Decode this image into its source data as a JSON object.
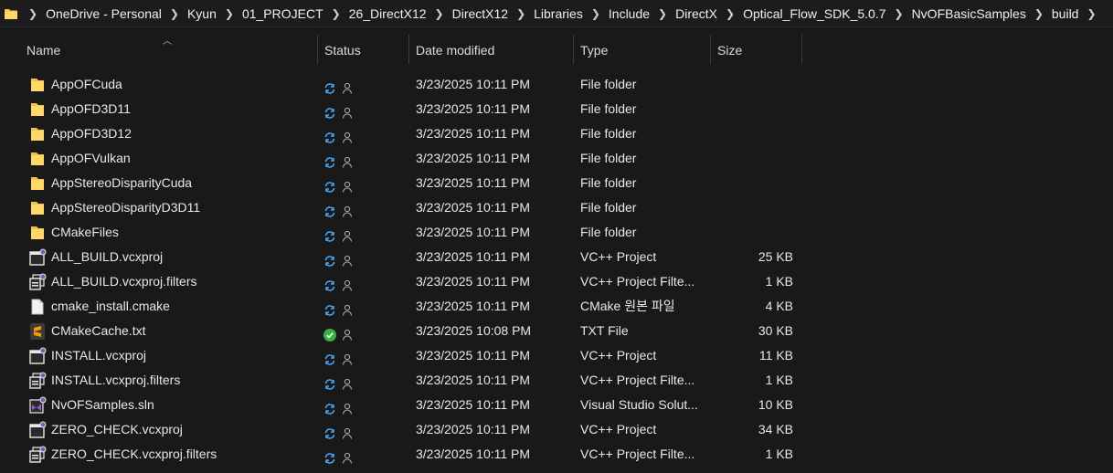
{
  "breadcrumbs": [
    "OneDrive - Personal",
    "Kyun",
    "01_PROJECT",
    "26_DirectX12",
    "DirectX12",
    "Libraries",
    "Include",
    "DirectX",
    "Optical_Flow_SDK_5.0.7",
    "NvOFBasicSamples",
    "build"
  ],
  "columns": {
    "name": "Name",
    "status": "Status",
    "date": "Date modified",
    "type": "Type",
    "size": "Size"
  },
  "colors": {
    "background": "#191919",
    "sync": "#4aa3f0",
    "ok": "#3cb043",
    "folder": "#f0c24b"
  },
  "files": [
    {
      "name": "AppOFCuda",
      "date": "3/23/2025 10:11 PM",
      "type": "File folder",
      "size": "",
      "icon": "folder-icon",
      "status": "sync"
    },
    {
      "name": "AppOFD3D11",
      "date": "3/23/2025 10:11 PM",
      "type": "File folder",
      "size": "",
      "icon": "folder-icon",
      "status": "sync"
    },
    {
      "name": "AppOFD3D12",
      "date": "3/23/2025 10:11 PM",
      "type": "File folder",
      "size": "",
      "icon": "folder-icon",
      "status": "sync"
    },
    {
      "name": "AppOFVulkan",
      "date": "3/23/2025 10:11 PM",
      "type": "File folder",
      "size": "",
      "icon": "folder-icon",
      "status": "sync"
    },
    {
      "name": "AppStereoDisparityCuda",
      "date": "3/23/2025 10:11 PM",
      "type": "File folder",
      "size": "",
      "icon": "folder-icon",
      "status": "sync"
    },
    {
      "name": "AppStereoDisparityD3D11",
      "date": "3/23/2025 10:11 PM",
      "type": "File folder",
      "size": "",
      "icon": "folder-icon",
      "status": "sync"
    },
    {
      "name": "CMakeFiles",
      "date": "3/23/2025 10:11 PM",
      "type": "File folder",
      "size": "",
      "icon": "folder-icon",
      "status": "sync"
    },
    {
      "name": "ALL_BUILD.vcxproj",
      "date": "3/23/2025 10:11 PM",
      "type": "VC++ Project",
      "size": "25 KB",
      "icon": "vcxproj-icon",
      "status": "sync"
    },
    {
      "name": "ALL_BUILD.vcxproj.filters",
      "date": "3/23/2025 10:11 PM",
      "type": "VC++ Project Filte...",
      "size": "1 KB",
      "icon": "vcxproj-filters-icon",
      "status": "sync"
    },
    {
      "name": "cmake_install.cmake",
      "date": "3/23/2025 10:11 PM",
      "type": "CMake 원본 파일",
      "size": "4 KB",
      "icon": "document-icon",
      "status": "sync"
    },
    {
      "name": "CMakeCache.txt",
      "date": "3/23/2025 10:08 PM",
      "type": "TXT File",
      "size": "30 KB",
      "icon": "sublime-text-icon",
      "status": "ok"
    },
    {
      "name": "INSTALL.vcxproj",
      "date": "3/23/2025 10:11 PM",
      "type": "VC++ Project",
      "size": "11 KB",
      "icon": "vcxproj-icon",
      "status": "sync"
    },
    {
      "name": "INSTALL.vcxproj.filters",
      "date": "3/23/2025 10:11 PM",
      "type": "VC++ Project Filte...",
      "size": "1 KB",
      "icon": "vcxproj-filters-icon",
      "status": "sync"
    },
    {
      "name": "NvOFSamples.sln",
      "date": "3/23/2025 10:11 PM",
      "type": "Visual Studio Solut...",
      "size": "10 KB",
      "icon": "visual-studio-solution-icon",
      "status": "sync"
    },
    {
      "name": "ZERO_CHECK.vcxproj",
      "date": "3/23/2025 10:11 PM",
      "type": "VC++ Project",
      "size": "34 KB",
      "icon": "vcxproj-icon",
      "status": "sync"
    },
    {
      "name": "ZERO_CHECK.vcxproj.filters",
      "date": "3/23/2025 10:11 PM",
      "type": "VC++ Project Filte...",
      "size": "1 KB",
      "icon": "vcxproj-filters-icon",
      "status": "sync"
    }
  ]
}
